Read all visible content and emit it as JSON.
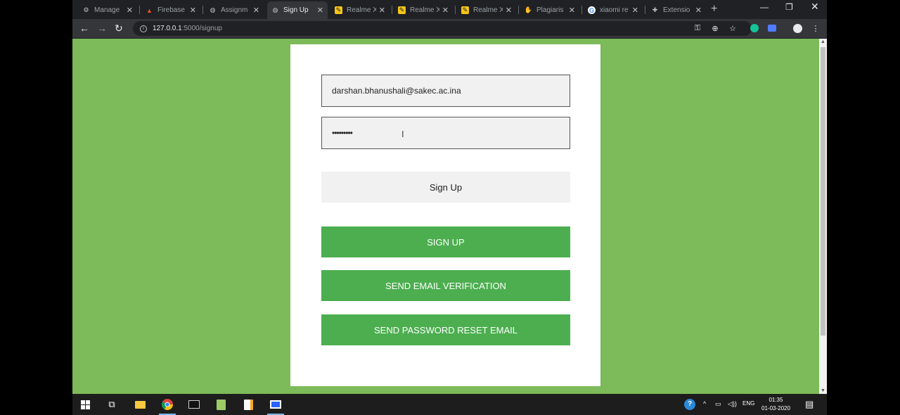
{
  "browser": {
    "tabs": [
      {
        "label": "Manage",
        "icon": "gear-icon",
        "active": false
      },
      {
        "label": "Firebase",
        "icon": "firebase-icon",
        "active": false
      },
      {
        "label": "Assignm",
        "icon": "globe-icon",
        "active": false
      },
      {
        "label": "Sign Up",
        "icon": "globe-icon",
        "active": true
      },
      {
        "label": "Realme X",
        "icon": "realme-icon",
        "active": false
      },
      {
        "label": "Realme X",
        "icon": "realme-icon",
        "active": false
      },
      {
        "label": "Realme X",
        "icon": "realme-icon",
        "active": false
      },
      {
        "label": "Plagiaris",
        "icon": "plagiarism-icon",
        "active": false
      },
      {
        "label": "xiaomi re",
        "icon": "google-icon",
        "active": false
      },
      {
        "label": "Extensio",
        "icon": "puzzle-icon",
        "active": false
      }
    ],
    "url_host": "127.0.0.1",
    "url_path": ":5000/signup"
  },
  "form": {
    "email_value": "darshan.bhanushali@sakec.ac.ina",
    "password_value": "•••••••••",
    "signup_plain_label": "Sign Up",
    "signup_label": "SIGN UP",
    "verify_label": "SEND EMAIL VERIFICATION",
    "reset_label": "SEND PASSWORD RESET EMAIL"
  },
  "colors": {
    "page_background": "#7dba59",
    "button_green": "#4cae4f",
    "card": "#ffffff"
  },
  "taskbar": {
    "language": "ENG",
    "time": "01:35",
    "date": "01-03-2020"
  }
}
